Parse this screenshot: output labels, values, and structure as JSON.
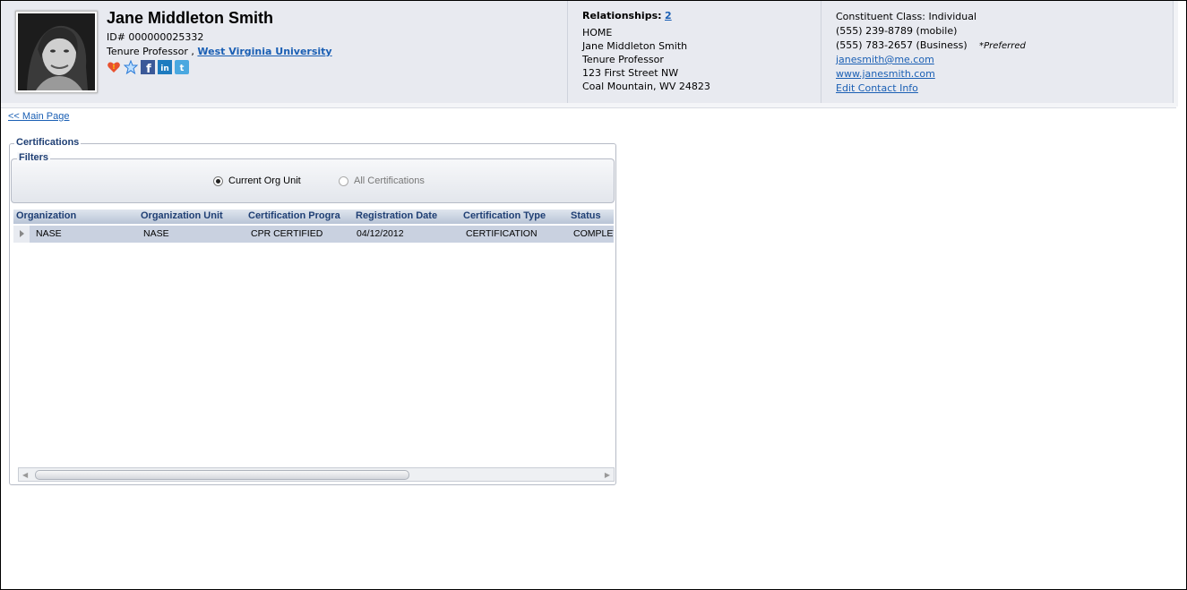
{
  "profile": {
    "name": "Jane Middleton Smith",
    "id_line": "ID# 000000025332",
    "title": "Tenure Professor ,",
    "university": "West Virginia University",
    "icons": [
      "heart-badge-icon",
      "star-icon",
      "facebook-icon",
      "linkedin-icon",
      "twitter-icon"
    ]
  },
  "relationships": {
    "label": "Relationships:",
    "count": "2",
    "address": {
      "type": "HOME",
      "name": "Jane Middleton Smith",
      "title": "Tenure Professor",
      "street": "123 First Street NW",
      "city": "Coal Mountain, WV 24823"
    }
  },
  "contact": {
    "constituent_class": "Constituent Class: Individual",
    "phone_mobile": "(555) 239-8789 (mobile)",
    "phone_business": "(555) 783-2657 (Business)",
    "preferred": "*Preferred",
    "email": "janesmith@me.com",
    "website": "www.janesmith.com",
    "edit": "Edit Contact Info"
  },
  "nav": {
    "main_page": "<< Main Page"
  },
  "certifications": {
    "title": "Certifications",
    "filters": {
      "title": "Filters",
      "current": "Current Org Unit",
      "all": "All Certifications"
    },
    "columns": [
      "Organization",
      "Organization Unit",
      "Certification Progra",
      "Registration Date",
      "Certification Type",
      "Status"
    ],
    "rows": [
      [
        "NASE",
        "NASE",
        "CPR CERTIFIED",
        "04/12/2012",
        "CERTIFICATION",
        "COMPLET"
      ]
    ]
  },
  "colors": {
    "link": "#1a5fb4",
    "header_bg": "#e8eaf0",
    "section_title": "#1f3f74"
  }
}
